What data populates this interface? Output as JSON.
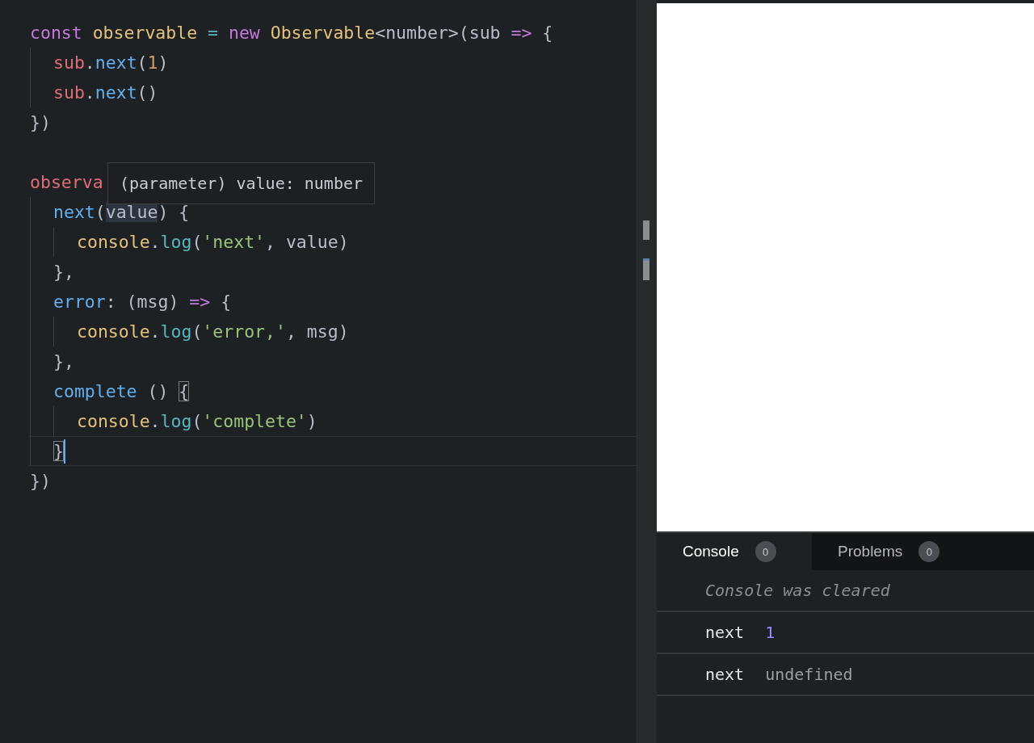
{
  "editor": {
    "lines": [
      {
        "current": false,
        "tokens": [
          {
            "text": "const ",
            "kind": "keyword"
          },
          {
            "text": "observable ",
            "kind": "type"
          },
          {
            "text": "= ",
            "kind": "method"
          },
          {
            "text": "new ",
            "kind": "keyword"
          },
          {
            "text": "Observable",
            "kind": "type"
          },
          {
            "text": "<number>(sub ",
            "kind": "plain"
          },
          {
            "text": "=>",
            "kind": "keyword"
          },
          {
            "text": " {",
            "kind": "plain"
          }
        ],
        "children": [
          {
            "current": false,
            "tokens": [
              {
                "text": "sub",
                "kind": "variable"
              },
              {
                "text": ".",
                "kind": "plain"
              },
              {
                "text": "next",
                "kind": "function"
              },
              {
                "text": "(",
                "kind": "plain"
              },
              {
                "text": "1",
                "kind": "number"
              },
              {
                "text": ")",
                "kind": "plain"
              }
            ]
          },
          {
            "current": false,
            "tokens": [
              {
                "text": "sub",
                "kind": "variable"
              },
              {
                "text": ".",
                "kind": "plain"
              },
              {
                "text": "next",
                "kind": "function"
              },
              {
                "text": "()",
                "kind": "plain"
              }
            ]
          }
        ]
      },
      {
        "current": false,
        "tokens": [
          {
            "text": "})",
            "kind": "plain"
          }
        ]
      },
      {
        "current": false
      },
      {
        "current": false,
        "tooltip": "(parameter) value: number",
        "tokens": [
          {
            "text": "observa",
            "kind": "variable"
          }
        ],
        "children": [
          {
            "current": false,
            "tokens": [
              {
                "text": "next",
                "kind": "function"
              },
              {
                "text": "(",
                "kind": "plain"
              },
              {
                "text": "value",
                "kind": "reference"
              },
              {
                "text": ") {",
                "kind": "plain"
              }
            ],
            "children": [
              {
                "current": false,
                "tokens": [
                  {
                    "text": "console",
                    "kind": "type"
                  },
                  {
                    "text": ".",
                    "kind": "plain"
                  },
                  {
                    "text": "log",
                    "kind": "method"
                  },
                  {
                    "text": "(",
                    "kind": "plain"
                  },
                  {
                    "text": "'next'",
                    "kind": "string"
                  },
                  {
                    "text": ", value)",
                    "kind": "plain"
                  }
                ]
              }
            ]
          },
          {
            "current": false,
            "tokens": [
              {
                "text": "},",
                "kind": "plain"
              }
            ]
          },
          {
            "current": false,
            "tokens": [
              {
                "text": "error",
                "kind": "function"
              },
              {
                "text": ": (msg) ",
                "kind": "plain"
              },
              {
                "text": "=>",
                "kind": "keyword"
              },
              {
                "text": " {",
                "kind": "plain"
              }
            ],
            "children": [
              {
                "current": false,
                "tokens": [
                  {
                    "text": "console",
                    "kind": "type"
                  },
                  {
                    "text": ".",
                    "kind": "plain"
                  },
                  {
                    "text": "log",
                    "kind": "method"
                  },
                  {
                    "text": "(",
                    "kind": "plain"
                  },
                  {
                    "text": "'error,'",
                    "kind": "string"
                  },
                  {
                    "text": ", msg)",
                    "kind": "plain"
                  }
                ]
              }
            ]
          },
          {
            "current": false,
            "tokens": [
              {
                "text": "},",
                "kind": "plain"
              }
            ]
          },
          {
            "current": false,
            "tokens": [
              {
                "text": "complete",
                "kind": "function"
              },
              {
                "text": " () ",
                "kind": "plain"
              },
              {
                "text": "{",
                "kind": "bracket-match"
              }
            ],
            "children": [
              {
                "current": false,
                "tokens": [
                  {
                    "text": "console",
                    "kind": "type"
                  },
                  {
                    "text": ".",
                    "kind": "plain"
                  },
                  {
                    "text": "log",
                    "kind": "method"
                  },
                  {
                    "text": "(",
                    "kind": "plain"
                  },
                  {
                    "text": "'complete'",
                    "kind": "string"
                  },
                  {
                    "text": ")",
                    "kind": "plain"
                  }
                ]
              }
            ]
          },
          {
            "current": true,
            "tokens": [
              {
                "text": "}",
                "kind": "bracket-match"
              }
            ]
          }
        ]
      },
      {
        "current": false,
        "tokens": [
          {
            "text": "})",
            "kind": "plain"
          }
        ]
      }
    ]
  },
  "console": {
    "tabs": [
      {
        "label": "Console",
        "count": "0",
        "selected": true
      },
      {
        "label": "Problems",
        "count": "0",
        "selected": false
      }
    ],
    "entries": [
      {
        "kind": "cleared",
        "text": "Console was cleared"
      },
      {
        "kind": "log-number",
        "label": "next",
        "value": "1"
      },
      {
        "kind": "log-undefined",
        "label": "next",
        "value": "undefined"
      }
    ]
  }
}
